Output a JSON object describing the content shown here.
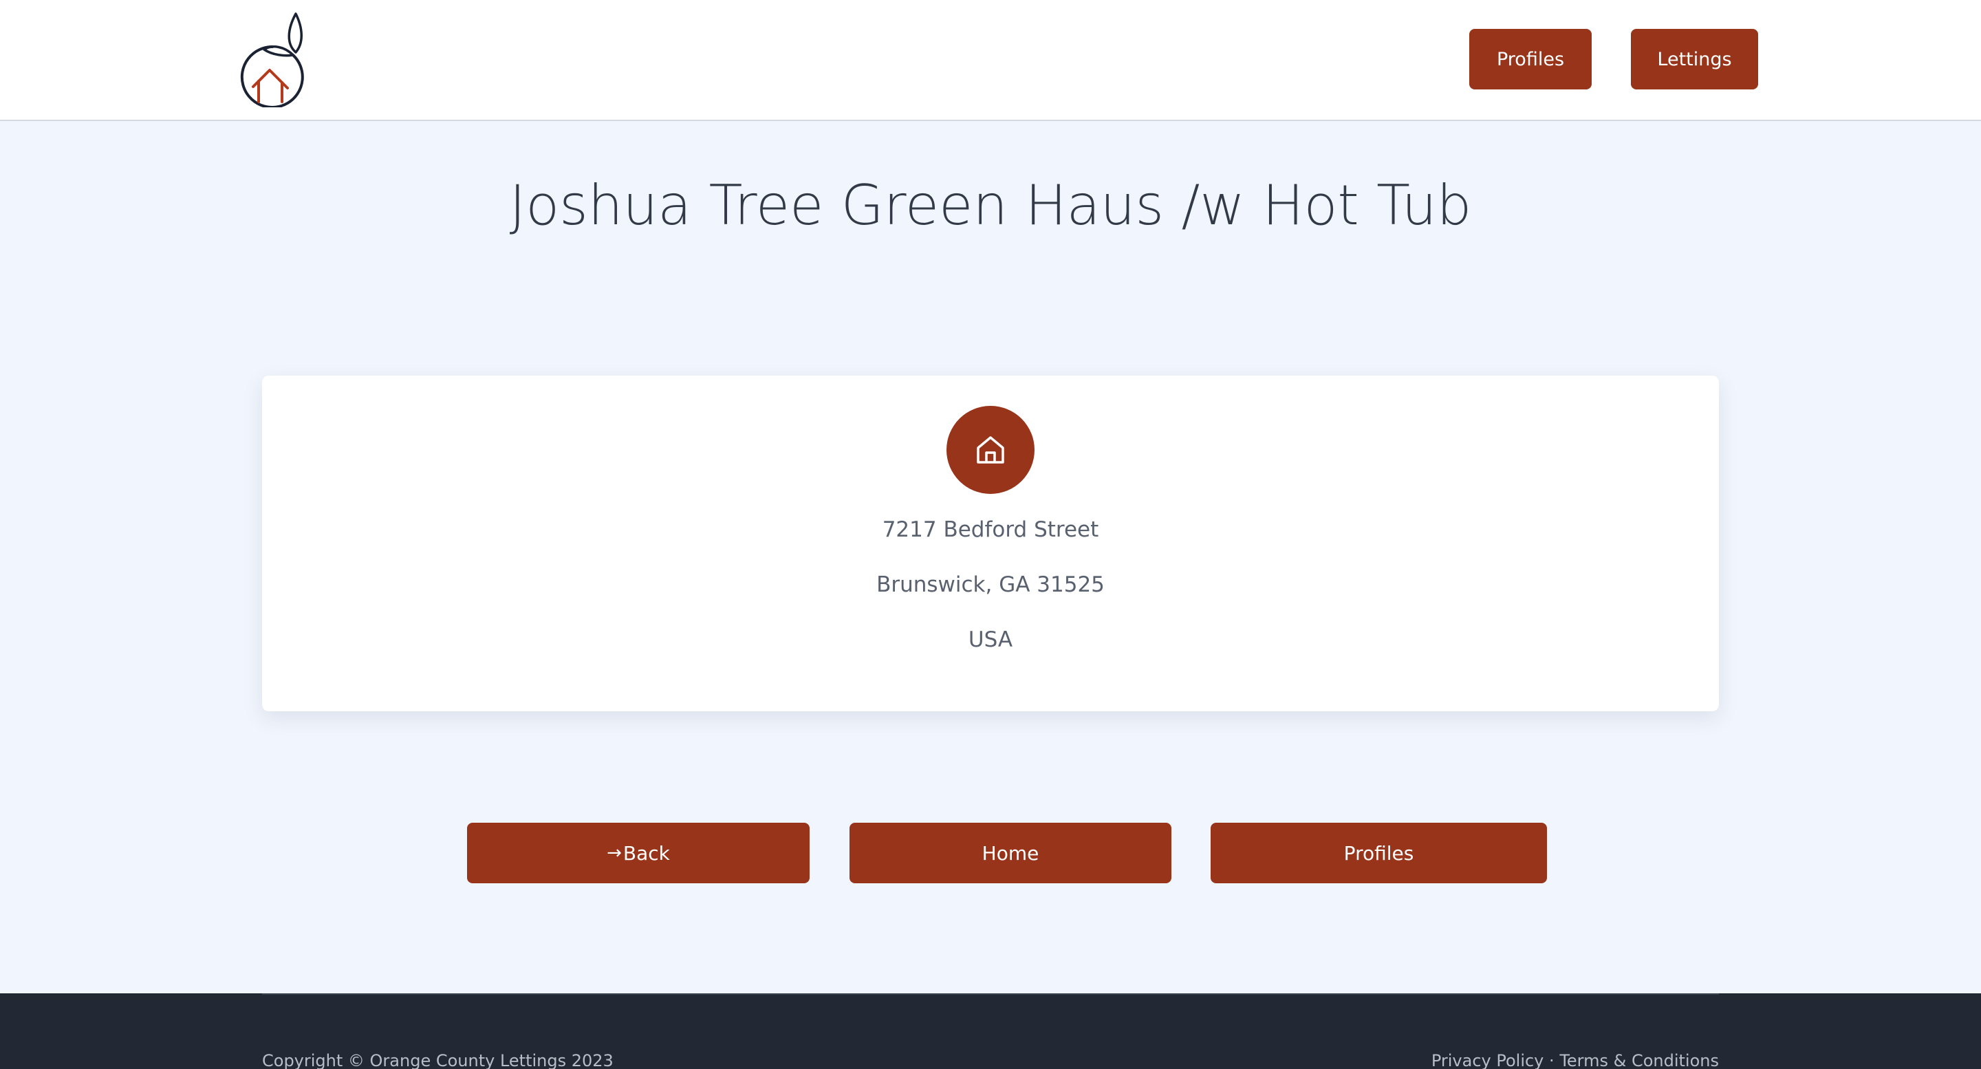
{
  "nav": {
    "profiles_label": "Profiles",
    "lettings_label": "Lettings"
  },
  "page": {
    "title": "Joshua Tree Green Haus /w Hot Tub"
  },
  "address": {
    "street": "7217 Bedford Street",
    "city_line": "Brunswick, GA 31525",
    "country": "USA"
  },
  "actions": {
    "back_label": "Back",
    "home_label": "Home",
    "profiles_label": "Profiles"
  },
  "footer": {
    "copyright": "Copyright © Orange County Lettings 2023",
    "privacy": "Privacy Policy",
    "separator": "·",
    "terms": "Terms & Conditions"
  },
  "icons": {
    "logo": "orange-house-logo",
    "home": "home-icon",
    "back": "arrow-right-icon"
  },
  "colors": {
    "accent": "#97341a",
    "page_bg": "#f1f5fd",
    "footer_bg": "#222834",
    "title_text": "#333a47"
  }
}
